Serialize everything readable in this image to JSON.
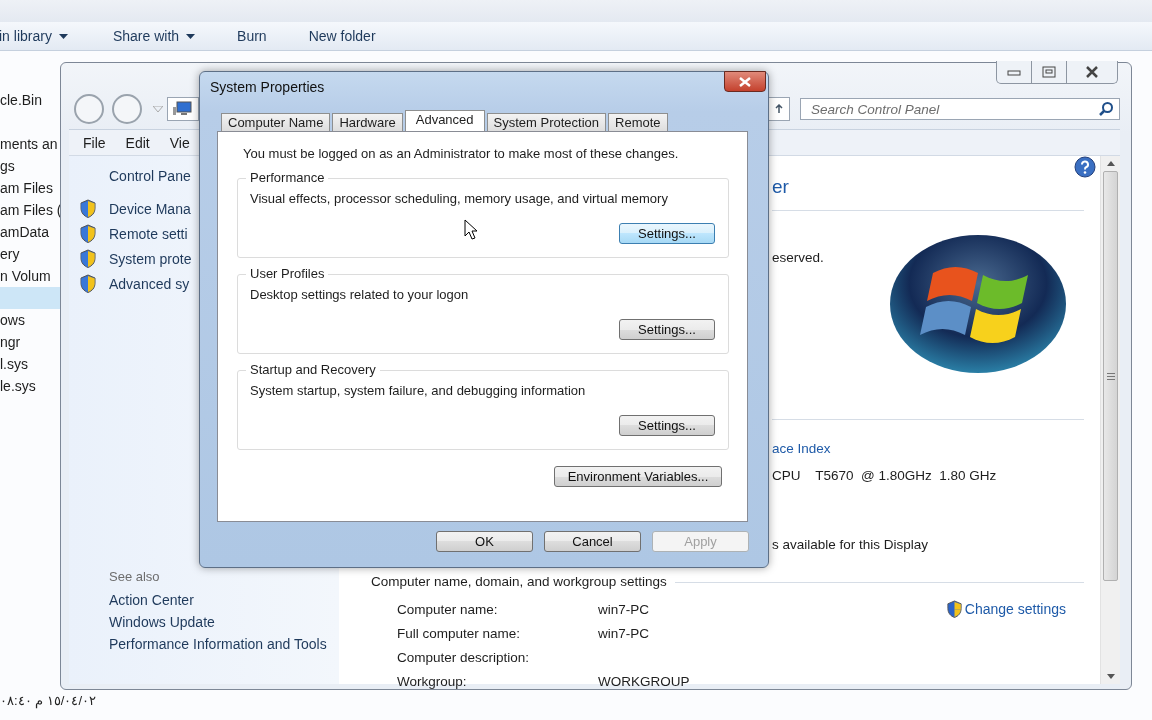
{
  "explorer": {
    "toolbar": [
      {
        "label": "in library",
        "dropdown": true
      },
      {
        "label": "Share with",
        "dropdown": true
      },
      {
        "label": "Burn",
        "dropdown": false
      },
      {
        "label": "New folder",
        "dropdown": false
      }
    ],
    "nav_items": [
      {
        "label": "cle.Bin",
        "selected": false
      },
      {
        "label": "ments an",
        "selected": false
      },
      {
        "label": "gs",
        "selected": false
      },
      {
        "label": "am Files",
        "selected": false
      },
      {
        "label": "am Files (",
        "selected": false
      },
      {
        "label": "amData",
        "selected": false
      },
      {
        "label": "ery",
        "selected": false
      },
      {
        "label": "n Volum",
        "selected": false
      },
      {
        "selected": true
      },
      {
        "label": "ows",
        "selected": false
      },
      {
        "label": "ngr",
        "selected": false
      },
      {
        "label": "l.sys",
        "selected": false
      },
      {
        "label": "le.sys",
        "selected": false
      }
    ],
    "status_text": "١٥/٠٤/٠٢ م ٠٨:٤٠"
  },
  "control_panel": {
    "search": {
      "placeholder": "Search Control Panel"
    },
    "menu": [
      "File",
      "Edit",
      "Vie"
    ],
    "left_pane": {
      "heading": "Control Pane",
      "tasks": [
        "Device Mana",
        "Remote setti",
        "System prote",
        "Advanced sy"
      ],
      "see_also_title": "See also",
      "see_also": [
        "Action Center",
        "Windows Update",
        "Performance Information and Tools"
      ]
    },
    "main": {
      "heading": "er",
      "copyright": "eserved.",
      "rating_link": "ace Index",
      "processor": "CPU    T5670  @ 1.80GHz  1.80 GHz",
      "pen_touch": "s available for this Display",
      "section_title": "Computer name, domain, and workgroup settings",
      "change_settings": "Change settings",
      "rows": [
        {
          "label": "Computer name:",
          "value": "win7-PC"
        },
        {
          "label": "Full computer name:",
          "value": "win7-PC"
        },
        {
          "label": "Computer description:"
        },
        {
          "label": "Workgroup:",
          "value": "WORKGROUP"
        }
      ]
    }
  },
  "dialog": {
    "title": "System Properties",
    "tabs": [
      {
        "label": "Computer Name",
        "selected": false
      },
      {
        "label": "Hardware",
        "selected": false
      },
      {
        "label": "Advanced",
        "selected": true
      },
      {
        "label": "System Protection",
        "selected": false
      },
      {
        "label": "Remote",
        "selected": false
      }
    ],
    "notice": "You must be logged on as an Administrator to make most of these changes.",
    "groups": [
      {
        "title": "Performance",
        "description": "Visual effects, processor scheduling, memory usage, and virtual memory",
        "button": "Settings...",
        "focused": true
      },
      {
        "title": "User Profiles",
        "description": "Desktop settings related to your logon",
        "button": "Settings...",
        "focused": false
      },
      {
        "title": "Startup and Recovery",
        "description": "System startup, system failure, and debugging information",
        "button": "Settings...",
        "focused": false
      }
    ],
    "env_button": "Environment Variables...",
    "buttons": [
      {
        "label": "OK",
        "disabled": false
      },
      {
        "label": "Cancel",
        "disabled": false
      },
      {
        "label": "Apply",
        "disabled": true
      }
    ]
  }
}
